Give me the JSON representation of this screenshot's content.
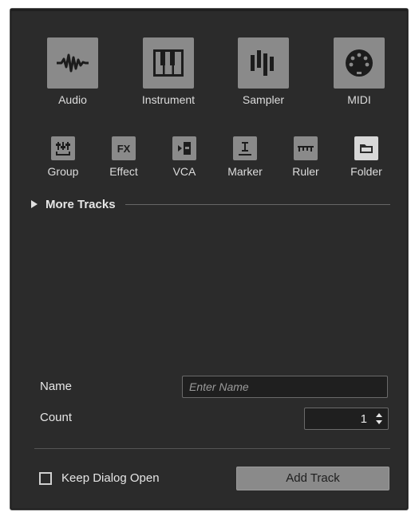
{
  "main_tracks": [
    {
      "label": "Audio",
      "icon": "waveform-icon"
    },
    {
      "label": "Instrument",
      "icon": "piano-keys-icon"
    },
    {
      "label": "Sampler",
      "icon": "sampler-bars-icon"
    },
    {
      "label": "MIDI",
      "icon": "midi-connector-icon"
    }
  ],
  "other_tracks": [
    {
      "label": "Group",
      "icon": "group-faders-icon"
    },
    {
      "label": "Effect",
      "icon": "fx-icon"
    },
    {
      "label": "VCA",
      "icon": "vca-icon"
    },
    {
      "label": "Marker",
      "icon": "marker-icon"
    },
    {
      "label": "Ruler",
      "icon": "ruler-icon"
    },
    {
      "label": "Folder",
      "icon": "folder-icon"
    }
  ],
  "more_tracks": {
    "label": "More Tracks"
  },
  "fx_text": "FX",
  "name_field": {
    "label": "Name",
    "placeholder": "Enter Name",
    "value": ""
  },
  "count_field": {
    "label": "Count",
    "value": "1"
  },
  "keep_dialog": {
    "label": "Keep Dialog Open",
    "checked": false
  },
  "add_button": {
    "label": "Add Track"
  },
  "colors": {
    "panel": "#2b2b2b",
    "tile": "#8a8a8a",
    "folder_tile": "#d8d8d8",
    "field_bg": "#1f1f1f"
  }
}
